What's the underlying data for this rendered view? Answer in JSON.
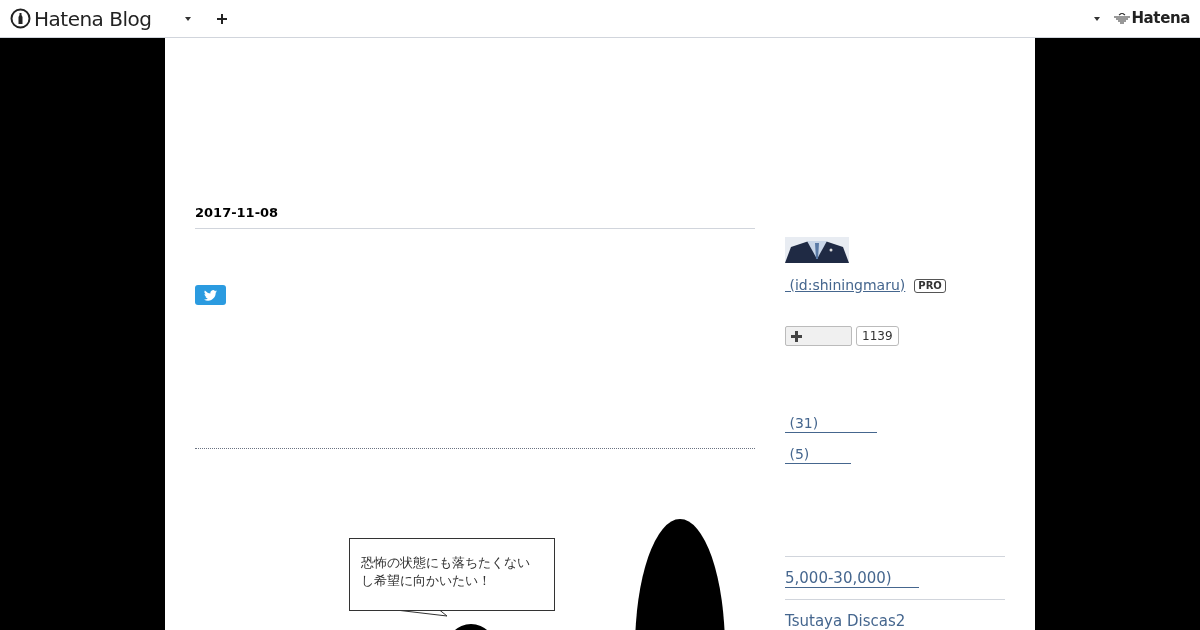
{
  "header": {
    "logo_text": "Hatena Blog",
    "hatena_text": "Hatena"
  },
  "article": {
    "date": "2017-11-08",
    "illustration": {
      "bubble_text": "恐怖の状態にも落ちたくないし希望に向かいたい！"
    }
  },
  "sidebar": {
    "author_link": " (id:shiningmaru)",
    "badge": "PRO",
    "subscribe_count": "1139",
    "categories": [
      {
        "label": " (31)"
      },
      {
        "label": " (5)"
      }
    ],
    "links": [
      {
        "label": "5,000-30,000)"
      },
      {
        "label": "Tsutaya Discas2"
      }
    ]
  }
}
